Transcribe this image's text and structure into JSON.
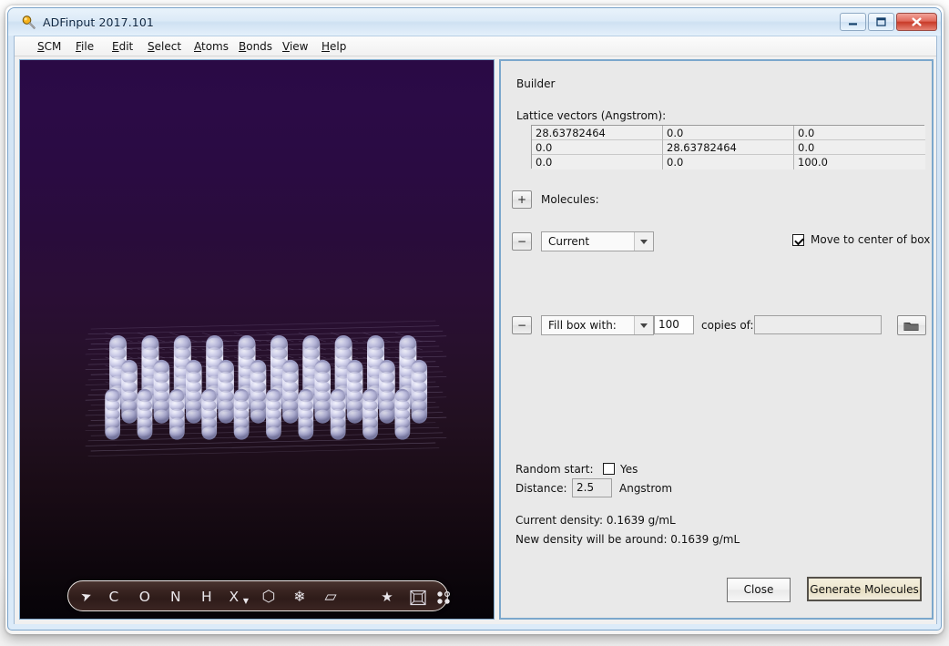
{
  "window": {
    "title": "ADFinput 2017.101",
    "icon": "magnifier-icon",
    "controls": {
      "minimize": "minimize-icon",
      "maximize": "maximize-icon",
      "close": "close-icon"
    }
  },
  "menubar": {
    "items": [
      {
        "label": "SCM",
        "accel": "S"
      },
      {
        "label": "File",
        "accel": "F"
      },
      {
        "label": "Edit",
        "accel": "E"
      },
      {
        "label": "Select",
        "accel": "S"
      },
      {
        "label": "Atoms",
        "accel": "A"
      },
      {
        "label": "Bonds",
        "accel": "B"
      },
      {
        "label": "View",
        "accel": "V"
      },
      {
        "label": "Help",
        "accel": "H"
      }
    ]
  },
  "viewer": {
    "toolbar": [
      {
        "name": "select-cursor-tool",
        "glyph": "➤"
      },
      {
        "name": "carbon-atom-tool",
        "glyph": "C"
      },
      {
        "name": "oxygen-atom-tool",
        "glyph": "O"
      },
      {
        "name": "nitrogen-atom-tool",
        "glyph": "N"
      },
      {
        "name": "hydrogen-atom-tool",
        "glyph": "H"
      },
      {
        "name": "other-element-tool",
        "glyph": "X"
      },
      {
        "name": "ring-tool",
        "glyph": "⬡"
      },
      {
        "name": "snowflake-symmetry-tool",
        "glyph": "❄"
      },
      {
        "name": "plane-tool",
        "glyph": "▱"
      },
      {
        "name": "star-tool",
        "glyph": "★"
      },
      {
        "name": "periodic-box-tool",
        "glyph": "▣"
      },
      {
        "name": "atoms-dots-tool",
        "glyph": "⁙"
      }
    ]
  },
  "builder": {
    "heading": "Builder",
    "lattice_label": "Lattice vectors (Angstrom):",
    "lattice_vectors": [
      [
        "28.63782464",
        "0.0",
        "0.0"
      ],
      [
        "0.0",
        "28.63782464",
        "0.0"
      ],
      [
        "0.0",
        "0.0",
        "100.0"
      ]
    ],
    "add_molecule_button": "+",
    "molecules_label": "Molecules:",
    "rows": [
      {
        "remove_button": "−",
        "select_value": "Current"
      },
      {
        "remove_button": "−",
        "select_value": "Fill box with:",
        "count": "100",
        "copies_label": "copies of:",
        "molecule_file": "",
        "browse_icon": "folder-icon"
      }
    ],
    "move_to_center": {
      "label": "Move to center of box",
      "checked": true
    },
    "random_start": {
      "label": "Random start:",
      "yes_label": "Yes",
      "checked": false
    },
    "distance": {
      "label": "Distance:",
      "value": "2.5",
      "unit": "Angstrom"
    },
    "current_density": "Current density: 0.1639 g/mL",
    "new_density": "New density will be around: 0.1639 g/mL",
    "close_button": "Close",
    "generate_button": "Generate Molecules"
  },
  "colors": {
    "panel_bg": "#e9e9e9",
    "panel_border": "#7ba7cc",
    "title_text": "#0b2440",
    "close_button": "#c83a28",
    "default_button": "#e6ddc0",
    "viewer_top": "#2a0a45",
    "viewer_bottom": "#060308",
    "atom_color": "#c8c8e8",
    "toolbar_bg": "#3a2522"
  }
}
